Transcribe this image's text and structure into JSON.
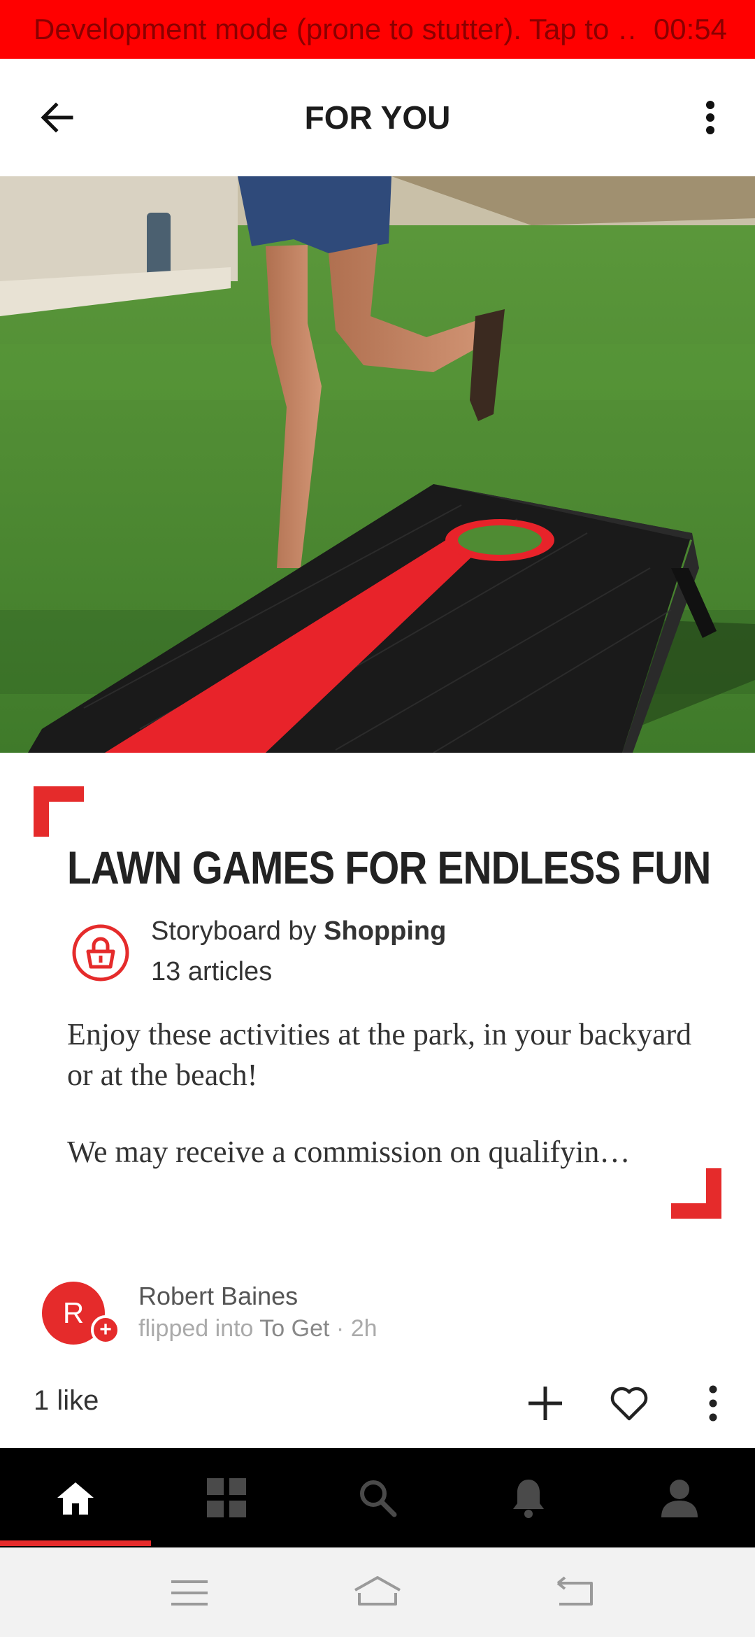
{
  "dev_banner": {
    "text": "Development mode (prone to stutter). Tap to …",
    "time": "00:54"
  },
  "header": {
    "title": "FOR YOU",
    "back_icon": "arrow-left-icon",
    "more_icon": "more-vertical-icon"
  },
  "hero": {
    "image_icon": "cornhole-board-photo"
  },
  "story": {
    "headline": "LAWN GAMES FOR ENDLESS FUN",
    "storyboard_prefix": "Storyboard by ",
    "storyboard_source": "Shopping",
    "article_count": "13 articles",
    "description": "Enjoy these activities at the park, in your backyard or at the beach!",
    "disclaimer": "We may receive a commission on qualifyin…",
    "shopping_icon": "shopping-bag-icon"
  },
  "flip": {
    "avatar_letter": "R",
    "user_name": "Robert Baines",
    "action_text": "flipped into ",
    "magazine": "To Get",
    "separator": " · ",
    "time_ago": "2h"
  },
  "actions": {
    "likes": "1 like",
    "add_icon": "plus-icon",
    "like_icon": "heart-icon",
    "more_icon": "more-vertical-icon"
  },
  "bottom_nav": {
    "items": [
      {
        "icon": "home-icon",
        "active": true
      },
      {
        "icon": "grid-icon",
        "active": false
      },
      {
        "icon": "search-icon",
        "active": false
      },
      {
        "icon": "bell-icon",
        "active": false
      },
      {
        "icon": "profile-icon",
        "active": false
      }
    ]
  },
  "colors": {
    "accent": "#e52b2b",
    "banner": "#ff0000",
    "nav_background": "#000000"
  }
}
